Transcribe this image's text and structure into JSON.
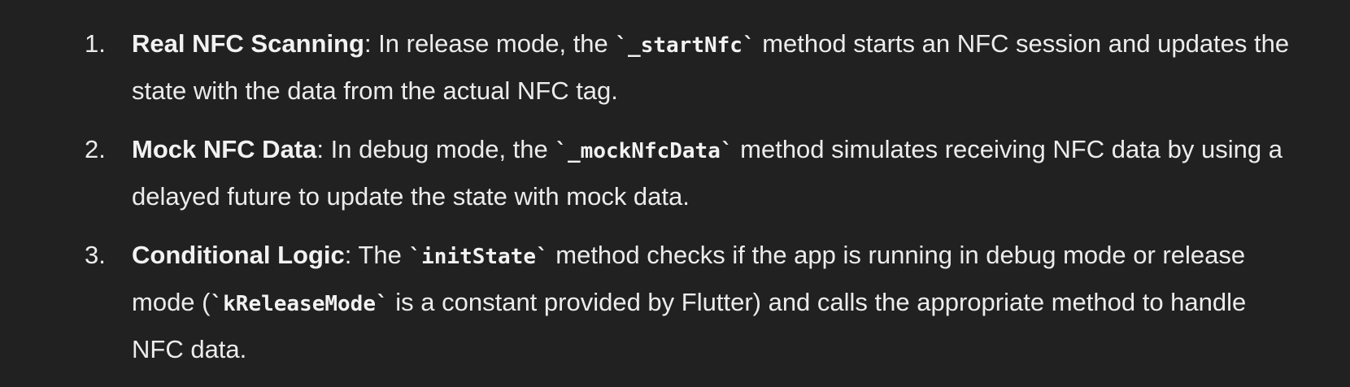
{
  "list": {
    "items": [
      {
        "number": "1.",
        "term": "Real NFC Scanning",
        "sep": ": ",
        "before_code": "In release mode, the ",
        "code": "`_startNfc`",
        "after_code": " method starts an NFC session and updates the state with the data from the actual NFC tag."
      },
      {
        "number": "2.",
        "term": "Mock NFC Data",
        "sep": ": ",
        "before_code": "In debug mode, the ",
        "code": "`_mockNfcData`",
        "after_code": " method simulates receiving NFC data by using a delayed future to update the state with mock data."
      },
      {
        "number": "3.",
        "term": "Conditional Logic",
        "sep": ": ",
        "before_code": "The ",
        "code": "`initState`",
        "middle": " method checks if the app is running in debug mode or release mode (",
        "code2": "`kReleaseMode`",
        "after_code": " is a constant provided by Flutter) and calls the appropriate method to handle NFC data."
      }
    ]
  }
}
